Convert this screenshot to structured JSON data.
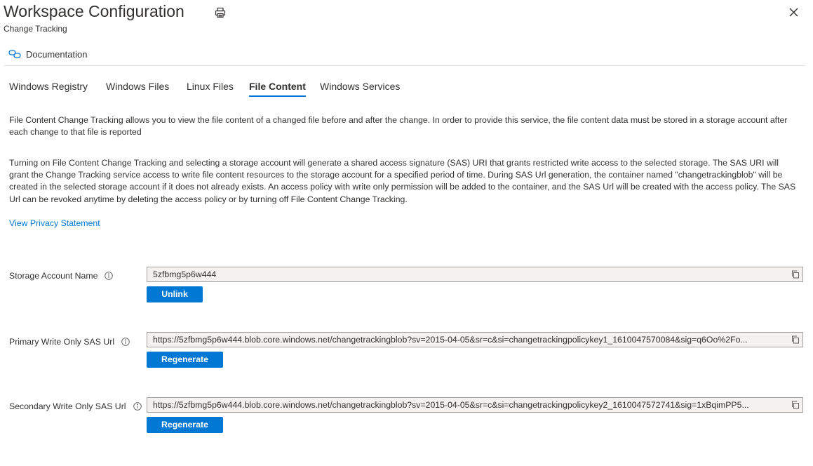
{
  "header": {
    "title": "Workspace Configuration",
    "subtitle": "Change Tracking"
  },
  "documentation": {
    "label": "Documentation"
  },
  "tabs": [
    {
      "label": "Windows Registry"
    },
    {
      "label": "Windows Files"
    },
    {
      "label": "Linux Files"
    },
    {
      "label": "File Content",
      "active": true
    },
    {
      "label": "Windows Services"
    }
  ],
  "content": {
    "paragraph1": "File Content Change Tracking allows you to view the file content of a changed file before and after the change. In order to provide this service, the file content data must be stored in a storage account after each change to that file is reported",
    "paragraph2": "Turning on File Content Change Tracking and selecting a storage account will generate a shared access signature (SAS) URI that grants restricted write access to the selected storage. The SAS URI will grant the Change Tracking service access to write file content resources to the storage account for a specified period of time. During SAS Url generation, the container named \"changetrackingblob\" will be created in the selected storage account if it does not already exists. An access policy with write only permission will be added to the container, and the SAS Url will be created with the access policy. The SAS Url can be revoked anytime by deleting the access policy or by turning off File Content Change Tracking.",
    "privacy_link": "View Privacy Statement"
  },
  "fields": {
    "storage_account": {
      "label": "Storage Account Name",
      "value": "5zfbmg5p6w444",
      "button": "Unlink"
    },
    "primary_sas": {
      "label": "Primary Write Only SAS Url",
      "value": "https://5zfbmg5p6w444.blob.core.windows.net/changetrackingblob?sv=2015-04-05&sr=c&si=changetrackingpolicykey1_1610047570084&sig=q6Oo%2Fo...",
      "button": "Regenerate"
    },
    "secondary_sas": {
      "label": "Secondary Write Only SAS Url",
      "value": "https://5zfbmg5p6w444.blob.core.windows.net/changetrackingblob?sv=2015-04-05&sr=c&si=changetrackingpolicykey2_1610047572741&sig=1xBqimPP5...",
      "button": "Regenerate"
    }
  },
  "colors": {
    "accent": "#0078d4",
    "text": "#323130",
    "field_bg": "#f3f2f1",
    "divider": "#e1dfdd"
  }
}
